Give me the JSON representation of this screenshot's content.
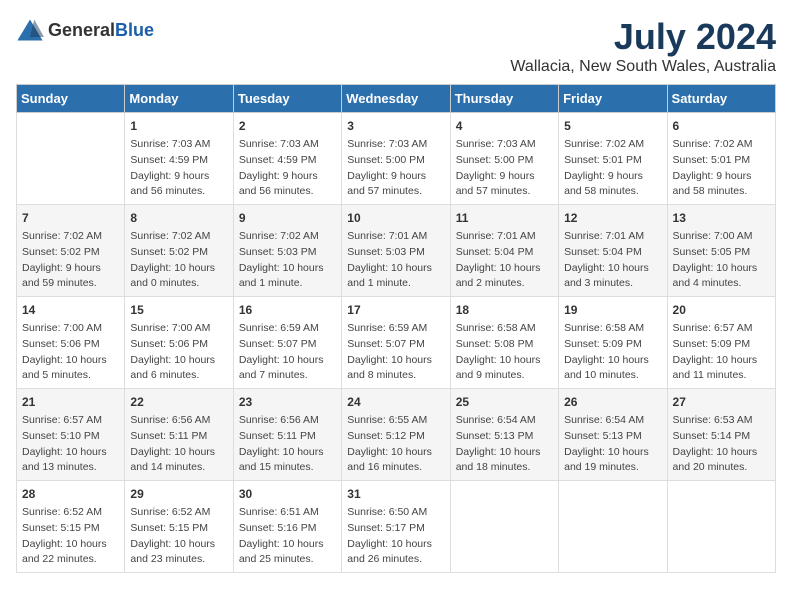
{
  "logo": {
    "text_general": "General",
    "text_blue": "Blue"
  },
  "title": "July 2024",
  "subtitle": "Wallacia, New South Wales, Australia",
  "days_header": [
    "Sunday",
    "Monday",
    "Tuesday",
    "Wednesday",
    "Thursday",
    "Friday",
    "Saturday"
  ],
  "weeks": [
    [
      {
        "day": "",
        "info": ""
      },
      {
        "day": "1",
        "info": "Sunrise: 7:03 AM\nSunset: 4:59 PM\nDaylight: 9 hours\nand 56 minutes."
      },
      {
        "day": "2",
        "info": "Sunrise: 7:03 AM\nSunset: 4:59 PM\nDaylight: 9 hours\nand 56 minutes."
      },
      {
        "day": "3",
        "info": "Sunrise: 7:03 AM\nSunset: 5:00 PM\nDaylight: 9 hours\nand 57 minutes."
      },
      {
        "day": "4",
        "info": "Sunrise: 7:03 AM\nSunset: 5:00 PM\nDaylight: 9 hours\nand 57 minutes."
      },
      {
        "day": "5",
        "info": "Sunrise: 7:02 AM\nSunset: 5:01 PM\nDaylight: 9 hours\nand 58 minutes."
      },
      {
        "day": "6",
        "info": "Sunrise: 7:02 AM\nSunset: 5:01 PM\nDaylight: 9 hours\nand 58 minutes."
      }
    ],
    [
      {
        "day": "7",
        "info": "Sunrise: 7:02 AM\nSunset: 5:02 PM\nDaylight: 9 hours\nand 59 minutes."
      },
      {
        "day": "8",
        "info": "Sunrise: 7:02 AM\nSunset: 5:02 PM\nDaylight: 10 hours\nand 0 minutes."
      },
      {
        "day": "9",
        "info": "Sunrise: 7:02 AM\nSunset: 5:03 PM\nDaylight: 10 hours\nand 1 minute."
      },
      {
        "day": "10",
        "info": "Sunrise: 7:01 AM\nSunset: 5:03 PM\nDaylight: 10 hours\nand 1 minute."
      },
      {
        "day": "11",
        "info": "Sunrise: 7:01 AM\nSunset: 5:04 PM\nDaylight: 10 hours\nand 2 minutes."
      },
      {
        "day": "12",
        "info": "Sunrise: 7:01 AM\nSunset: 5:04 PM\nDaylight: 10 hours\nand 3 minutes."
      },
      {
        "day": "13",
        "info": "Sunrise: 7:00 AM\nSunset: 5:05 PM\nDaylight: 10 hours\nand 4 minutes."
      }
    ],
    [
      {
        "day": "14",
        "info": "Sunrise: 7:00 AM\nSunset: 5:06 PM\nDaylight: 10 hours\nand 5 minutes."
      },
      {
        "day": "15",
        "info": "Sunrise: 7:00 AM\nSunset: 5:06 PM\nDaylight: 10 hours\nand 6 minutes."
      },
      {
        "day": "16",
        "info": "Sunrise: 6:59 AM\nSunset: 5:07 PM\nDaylight: 10 hours\nand 7 minutes."
      },
      {
        "day": "17",
        "info": "Sunrise: 6:59 AM\nSunset: 5:07 PM\nDaylight: 10 hours\nand 8 minutes."
      },
      {
        "day": "18",
        "info": "Sunrise: 6:58 AM\nSunset: 5:08 PM\nDaylight: 10 hours\nand 9 minutes."
      },
      {
        "day": "19",
        "info": "Sunrise: 6:58 AM\nSunset: 5:09 PM\nDaylight: 10 hours\nand 10 minutes."
      },
      {
        "day": "20",
        "info": "Sunrise: 6:57 AM\nSunset: 5:09 PM\nDaylight: 10 hours\nand 11 minutes."
      }
    ],
    [
      {
        "day": "21",
        "info": "Sunrise: 6:57 AM\nSunset: 5:10 PM\nDaylight: 10 hours\nand 13 minutes."
      },
      {
        "day": "22",
        "info": "Sunrise: 6:56 AM\nSunset: 5:11 PM\nDaylight: 10 hours\nand 14 minutes."
      },
      {
        "day": "23",
        "info": "Sunrise: 6:56 AM\nSunset: 5:11 PM\nDaylight: 10 hours\nand 15 minutes."
      },
      {
        "day": "24",
        "info": "Sunrise: 6:55 AM\nSunset: 5:12 PM\nDaylight: 10 hours\nand 16 minutes."
      },
      {
        "day": "25",
        "info": "Sunrise: 6:54 AM\nSunset: 5:13 PM\nDaylight: 10 hours\nand 18 minutes."
      },
      {
        "day": "26",
        "info": "Sunrise: 6:54 AM\nSunset: 5:13 PM\nDaylight: 10 hours\nand 19 minutes."
      },
      {
        "day": "27",
        "info": "Sunrise: 6:53 AM\nSunset: 5:14 PM\nDaylight: 10 hours\nand 20 minutes."
      }
    ],
    [
      {
        "day": "28",
        "info": "Sunrise: 6:52 AM\nSunset: 5:15 PM\nDaylight: 10 hours\nand 22 minutes."
      },
      {
        "day": "29",
        "info": "Sunrise: 6:52 AM\nSunset: 5:15 PM\nDaylight: 10 hours\nand 23 minutes."
      },
      {
        "day": "30",
        "info": "Sunrise: 6:51 AM\nSunset: 5:16 PM\nDaylight: 10 hours\nand 25 minutes."
      },
      {
        "day": "31",
        "info": "Sunrise: 6:50 AM\nSunset: 5:17 PM\nDaylight: 10 hours\nand 26 minutes."
      },
      {
        "day": "",
        "info": ""
      },
      {
        "day": "",
        "info": ""
      },
      {
        "day": "",
        "info": ""
      }
    ]
  ]
}
